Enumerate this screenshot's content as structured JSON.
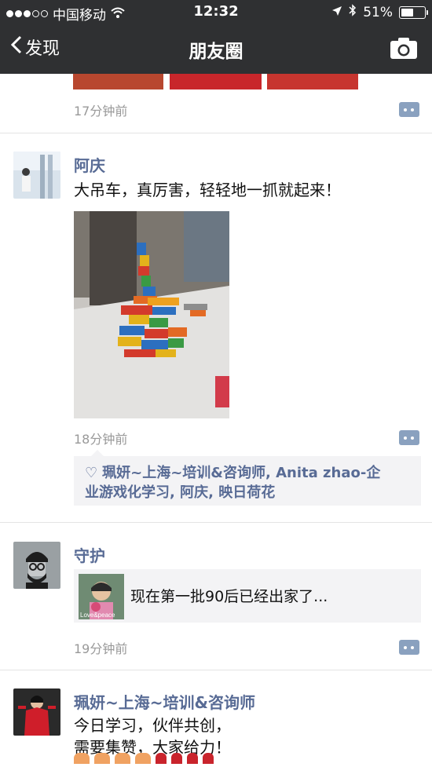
{
  "status_bar": {
    "carrier": "中国移动",
    "time": "12:32",
    "battery": "51%"
  },
  "nav": {
    "back_label": "发现",
    "title": "朋友圈"
  },
  "posts": [
    {
      "time": "17分钟前"
    },
    {
      "author": "阿庆",
      "text": "大吊车，真厉害，轻轻地一抓就起来！",
      "time": "18分钟前",
      "likes": "珮妍~上海~培训&咨询师, Anita zhao-企业游戏化学习, 阿庆, 映日荷花",
      "likes_line1": "珮妍~上海~培训&咨询师, Anita zhao-企",
      "likes_line2": "业游戏化学习, 阿庆, 映日荷花"
    },
    {
      "author": "守护",
      "share_title": "现在第一批90后已经出家了...",
      "share_thumb_caption": "Love&peace",
      "time": "19分钟前"
    },
    {
      "author": "珮妍~上海~培训&咨询师",
      "text_line1": "今日学习，伙伴共创，",
      "text_line2": "需要集赞，大家给力！"
    }
  ],
  "colors": {
    "nav_bg": "#2f3032",
    "name_link": "#586b95",
    "time_gray": "#999999",
    "more_button": "#8aa1bf",
    "likes_bg": "#f3f3f5"
  }
}
